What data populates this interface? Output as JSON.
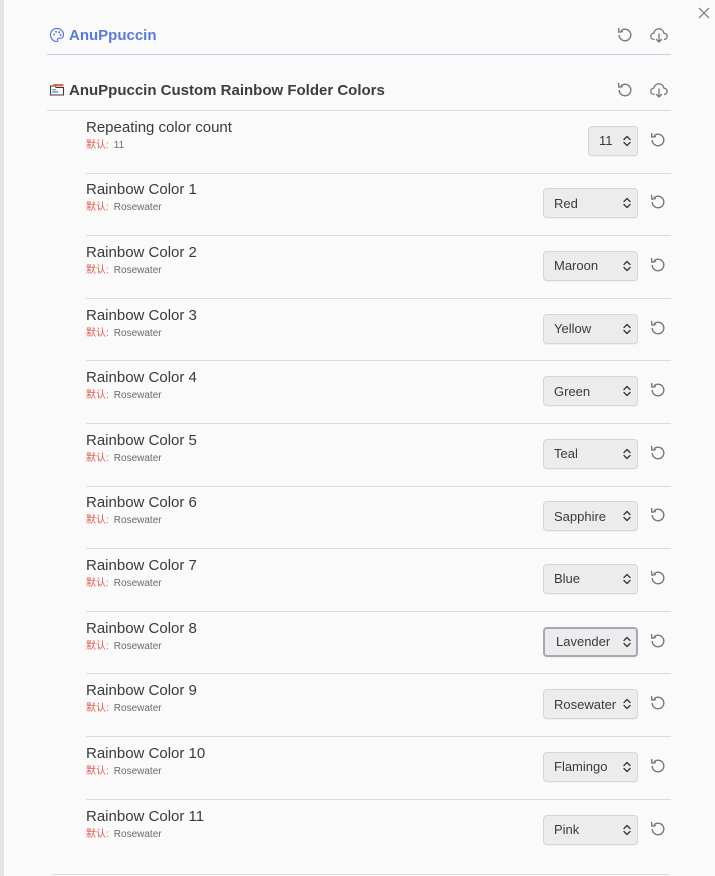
{
  "sections": [
    {
      "title": "AnuPpuccin",
      "icon": "palette-icon"
    },
    {
      "title": "AnuPpuccin Custom Rainbow Folder Colors",
      "icon": "folder-colors-icon"
    }
  ],
  "default_label": "默认:",
  "settings": [
    {
      "name": "Repeating color count",
      "default": "11",
      "value": "11"
    },
    {
      "name": "Rainbow Color 1",
      "default": "Rosewater",
      "value": "Red"
    },
    {
      "name": "Rainbow Color 2",
      "default": "Rosewater",
      "value": "Maroon"
    },
    {
      "name": "Rainbow Color 3",
      "default": "Rosewater",
      "value": "Yellow"
    },
    {
      "name": "Rainbow Color 4",
      "default": "Rosewater",
      "value": "Green"
    },
    {
      "name": "Rainbow Color 5",
      "default": "Rosewater",
      "value": "Teal"
    },
    {
      "name": "Rainbow Color 6",
      "default": "Rosewater",
      "value": "Sapphire"
    },
    {
      "name": "Rainbow Color 7",
      "default": "Rosewater",
      "value": "Blue"
    },
    {
      "name": "Rainbow Color 8",
      "default": "Rosewater",
      "value": "Lavender"
    },
    {
      "name": "Rainbow Color 9",
      "default": "Rosewater",
      "value": "Rosewater"
    },
    {
      "name": "Rainbow Color 10",
      "default": "Rosewater",
      "value": "Flamingo"
    },
    {
      "name": "Rainbow Color 11",
      "default": "Rosewater",
      "value": "Pink"
    }
  ],
  "icons": {
    "close": "close-icon",
    "reset": "reset-icon",
    "download": "download-cloud-icon",
    "chevron": "chevron-up-down-icon"
  },
  "colors": {
    "accent": "#5a7ad8",
    "default_label": "#e05b4f"
  }
}
